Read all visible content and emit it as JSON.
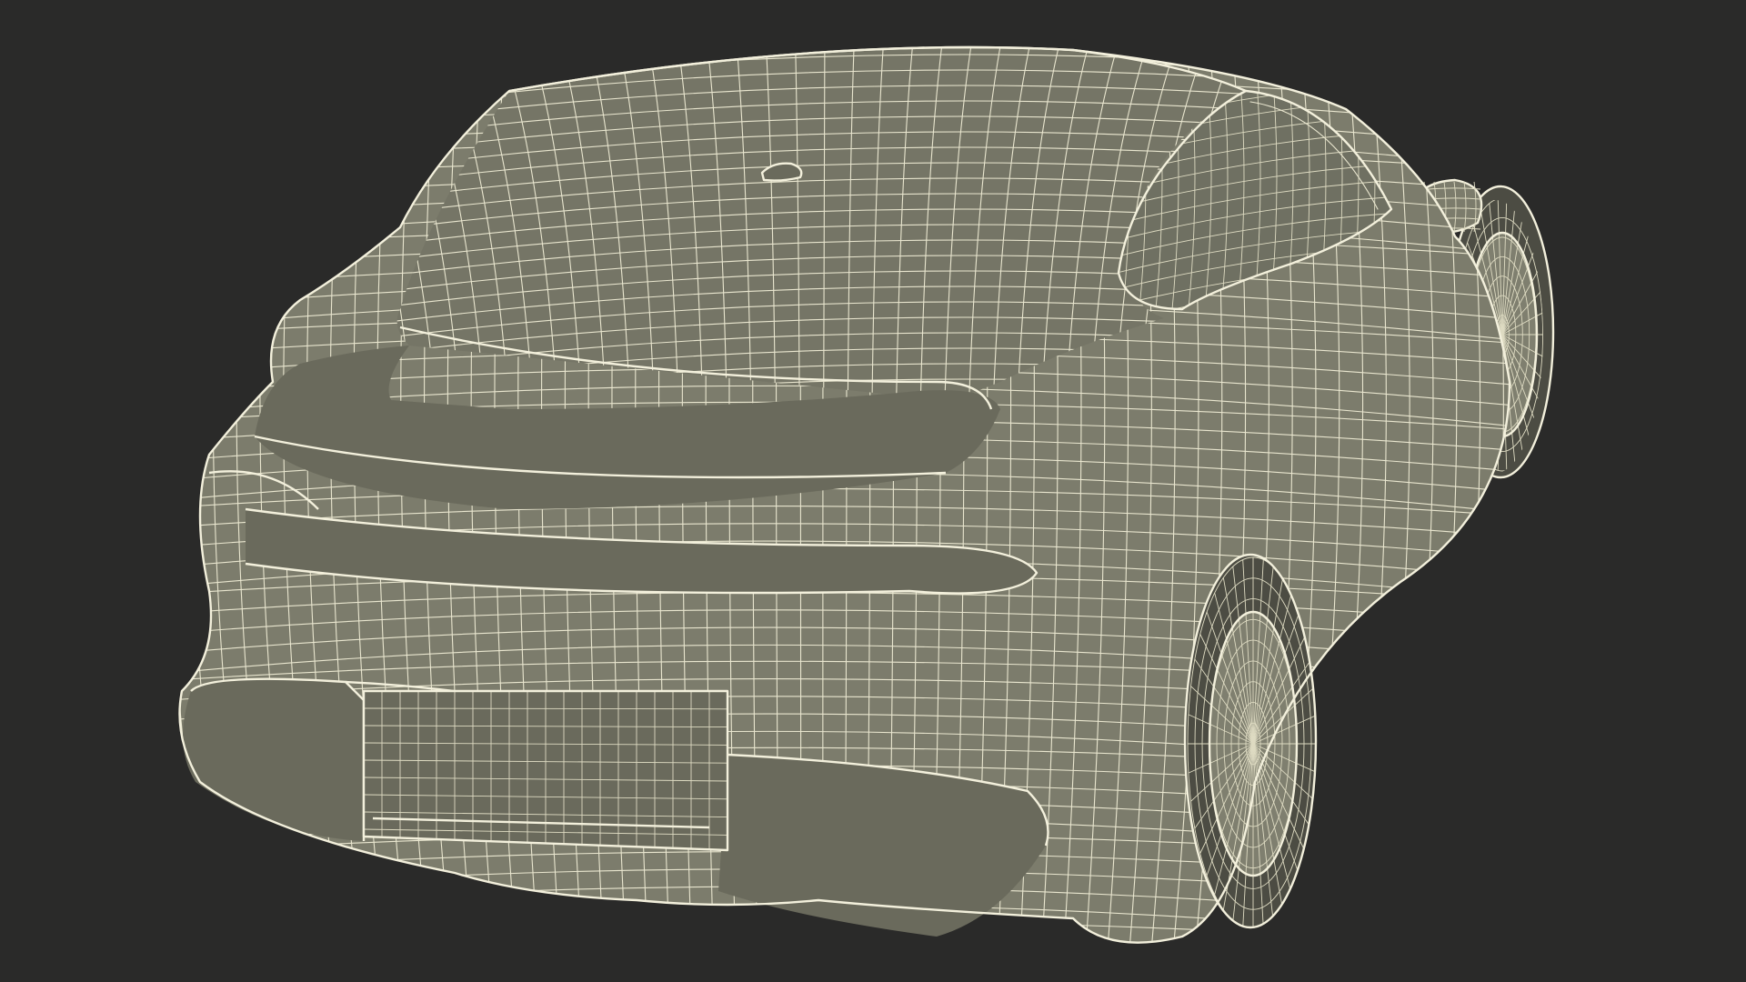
{
  "scene": {
    "subject": "car-wireframe",
    "view": "rear-three-quarter",
    "colors": {
      "background": "#2a2a29",
      "surface": "#7c7c6c",
      "wire": "#e9e6cf"
    }
  }
}
